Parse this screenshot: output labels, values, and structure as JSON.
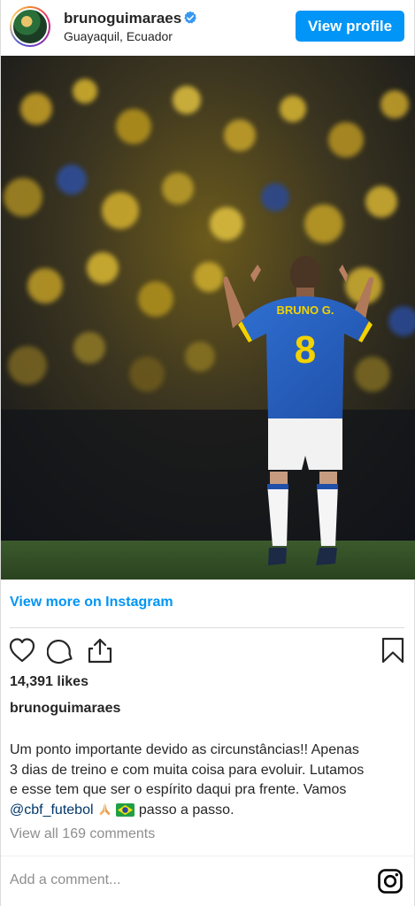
{
  "header": {
    "username": "brunoguimaraes",
    "location": "Guayaquil, Ecuador",
    "view_profile_label": "View profile"
  },
  "post": {
    "jersey_name": "BRUNO G.",
    "jersey_number": "8",
    "view_more_label": "View more on Instagram",
    "likes": "14,391 likes",
    "author": "brunoguimaraes",
    "caption_line1": "Um ponto importante devido as circunstâncias!! Apenas",
    "caption_line2": "3 dias de treino e com muita coisa para evoluir. Lutamos",
    "caption_line3": "e esse tem que ser o espírito daqui pra frente. Vamos",
    "caption_mention": "@cbf_futebol",
    "caption_end": "passo a passo.",
    "comments_label": "View all 169 comments",
    "add_comment_placeholder": "Add a comment..."
  },
  "colors": {
    "accent": "#0095f6",
    "verified": "#3897f0",
    "mention": "#00376b",
    "muted": "#8e8e8e"
  },
  "icons": [
    "verified-badge-icon",
    "heart-icon",
    "comment-icon",
    "share-icon",
    "bookmark-icon",
    "instagram-icon",
    "praying-hands-icon",
    "brazil-flag-icon"
  ]
}
